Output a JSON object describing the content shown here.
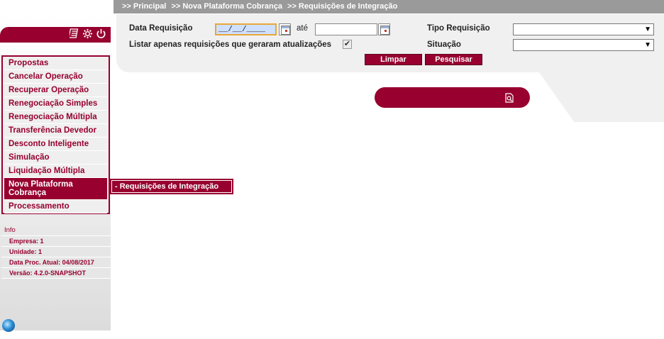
{
  "breadcrumb": {
    "items": [
      ">> Principal",
      ">> Nova Plataforma Cobrança",
      ">> Requisições de Integração"
    ]
  },
  "toolbar": {
    "icons": [
      "calculator-icon",
      "gear-icon",
      "power-icon"
    ]
  },
  "menu": {
    "items": [
      {
        "label": "Propostas"
      },
      {
        "label": "Cancelar Operação"
      },
      {
        "label": "Recuperar Operação"
      },
      {
        "label": "Renegociação Simples"
      },
      {
        "label": "Renegociação Múltipla"
      },
      {
        "label": "Transferência Devedor"
      },
      {
        "label": "Desconto Inteligente"
      },
      {
        "label": "Simulação"
      },
      {
        "label": "Liquidação Múltipla"
      },
      {
        "label": "Nova Plataforma Cobrança",
        "active": true
      },
      {
        "label": "Processamento"
      }
    ],
    "submenu": {
      "label": "- Requisições de Integração"
    }
  },
  "info": {
    "title": "Info",
    "rows": [
      "Empresa: 1",
      "Unidade: 1",
      "Data Proc. Atual: 04/08/2017",
      "Versão: 4.2.0-SNAPSHOT"
    ]
  },
  "filters": {
    "data_requisicao_label": "Data Requisição",
    "date_from_value": "__/__/____",
    "ate_label": "até",
    "date_to_value": "",
    "checkbox_label": "Listar apenas requisições que geraram atualizações",
    "checkbox_checked": true,
    "checkbox_mark": "✔",
    "tipo_label": "Tipo Requisição",
    "tipo_value": "",
    "situacao_label": "Situação",
    "situacao_value": "",
    "dropdown_arrow": "▼"
  },
  "buttons": {
    "limpar": "Limpar",
    "pesquisar": "Pesquisar"
  },
  "colors": {
    "brand": "#97002f",
    "panel": "#f0f0f0",
    "breadcrumb_bg": "#9a9a9a"
  }
}
